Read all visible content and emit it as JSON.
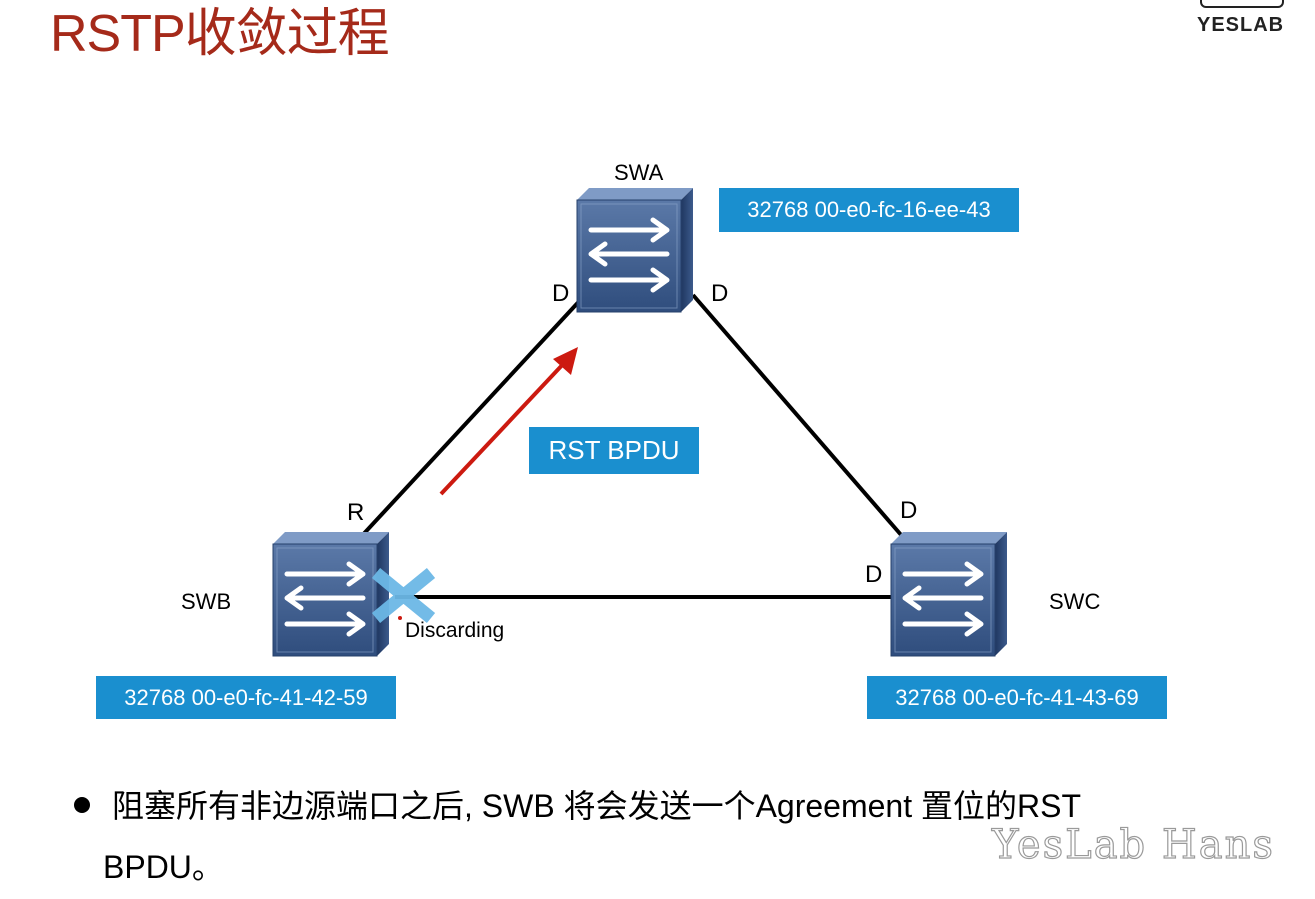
{
  "title": "RSTP收敛过程",
  "logo": {
    "text": "YESLAB"
  },
  "switches": {
    "swa": {
      "name": "SWA",
      "id": "32768 00-e0-fc-16-ee-43"
    },
    "swb": {
      "name": "SWB",
      "id": "32768 00-e0-fc-41-42-59"
    },
    "swc": {
      "name": "SWC",
      "id": "32768 00-e0-fc-41-43-69"
    }
  },
  "ports": {
    "swa_left": "D",
    "swa_right": "D",
    "swb_top": "R",
    "swc_top": "D",
    "swc_left": "D",
    "swb_right_state": "Discarding"
  },
  "message": {
    "label": "RST BPDU"
  },
  "bullet": {
    "line1": "阻塞所有非边源端口之后, SWB 将会发送一个Agreement 置位的RST",
    "line2": "BPDU。"
  },
  "watermark": "YesLab Hans",
  "colors": {
    "title": "#a52a1a",
    "id_box": "#1a8fcf",
    "arrow": "#cc1a10",
    "block_x": "#6cb8e6",
    "link": "#000000"
  }
}
